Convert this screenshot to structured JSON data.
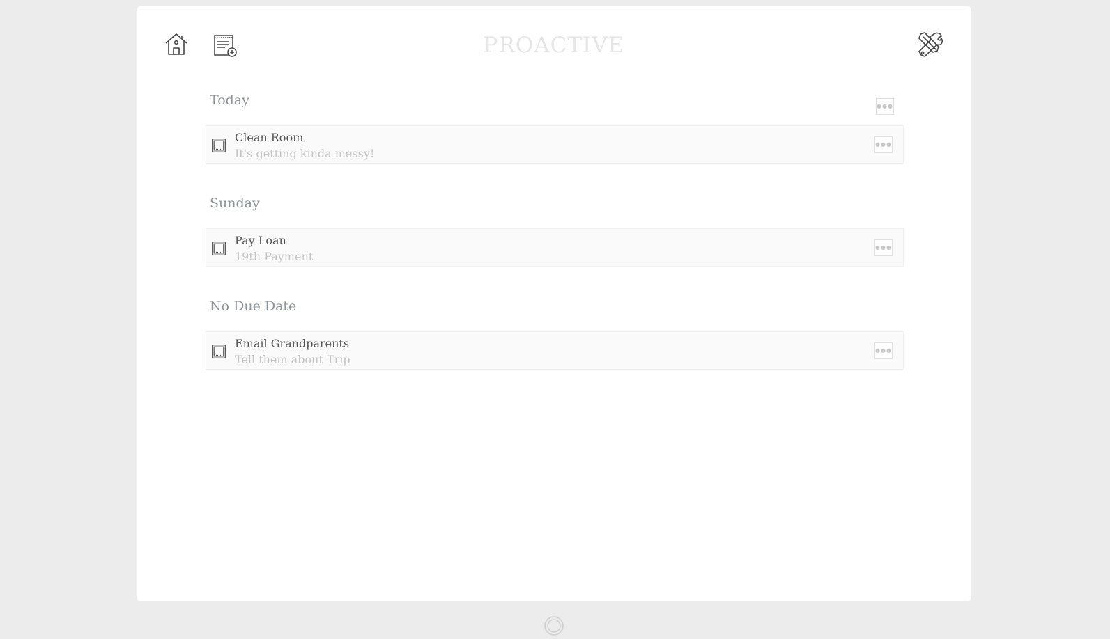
{
  "app": {
    "title": "PROACTIVE"
  },
  "toolbar": {
    "home_icon": "home-icon",
    "add_note_icon": "add-note-icon",
    "settings_icon": "tools-icon"
  },
  "sections": [
    {
      "title": "Today",
      "tasks": [
        {
          "title": "Clean Room",
          "description": "It's getting kinda messy!"
        }
      ]
    },
    {
      "title": "Sunday",
      "tasks": [
        {
          "title": "Pay Loan",
          "description": "19th Payment"
        }
      ]
    },
    {
      "title": "No Due Date",
      "tasks": [
        {
          "title": "Email Grandparents",
          "description": "Tell them about Trip"
        }
      ]
    }
  ],
  "colors": {
    "background": "#ececec",
    "card": "#ffffff",
    "title": "#e6e6e6",
    "section_title": "#8c9499",
    "task_title": "#555555",
    "task_description": "#c4c4c4"
  }
}
